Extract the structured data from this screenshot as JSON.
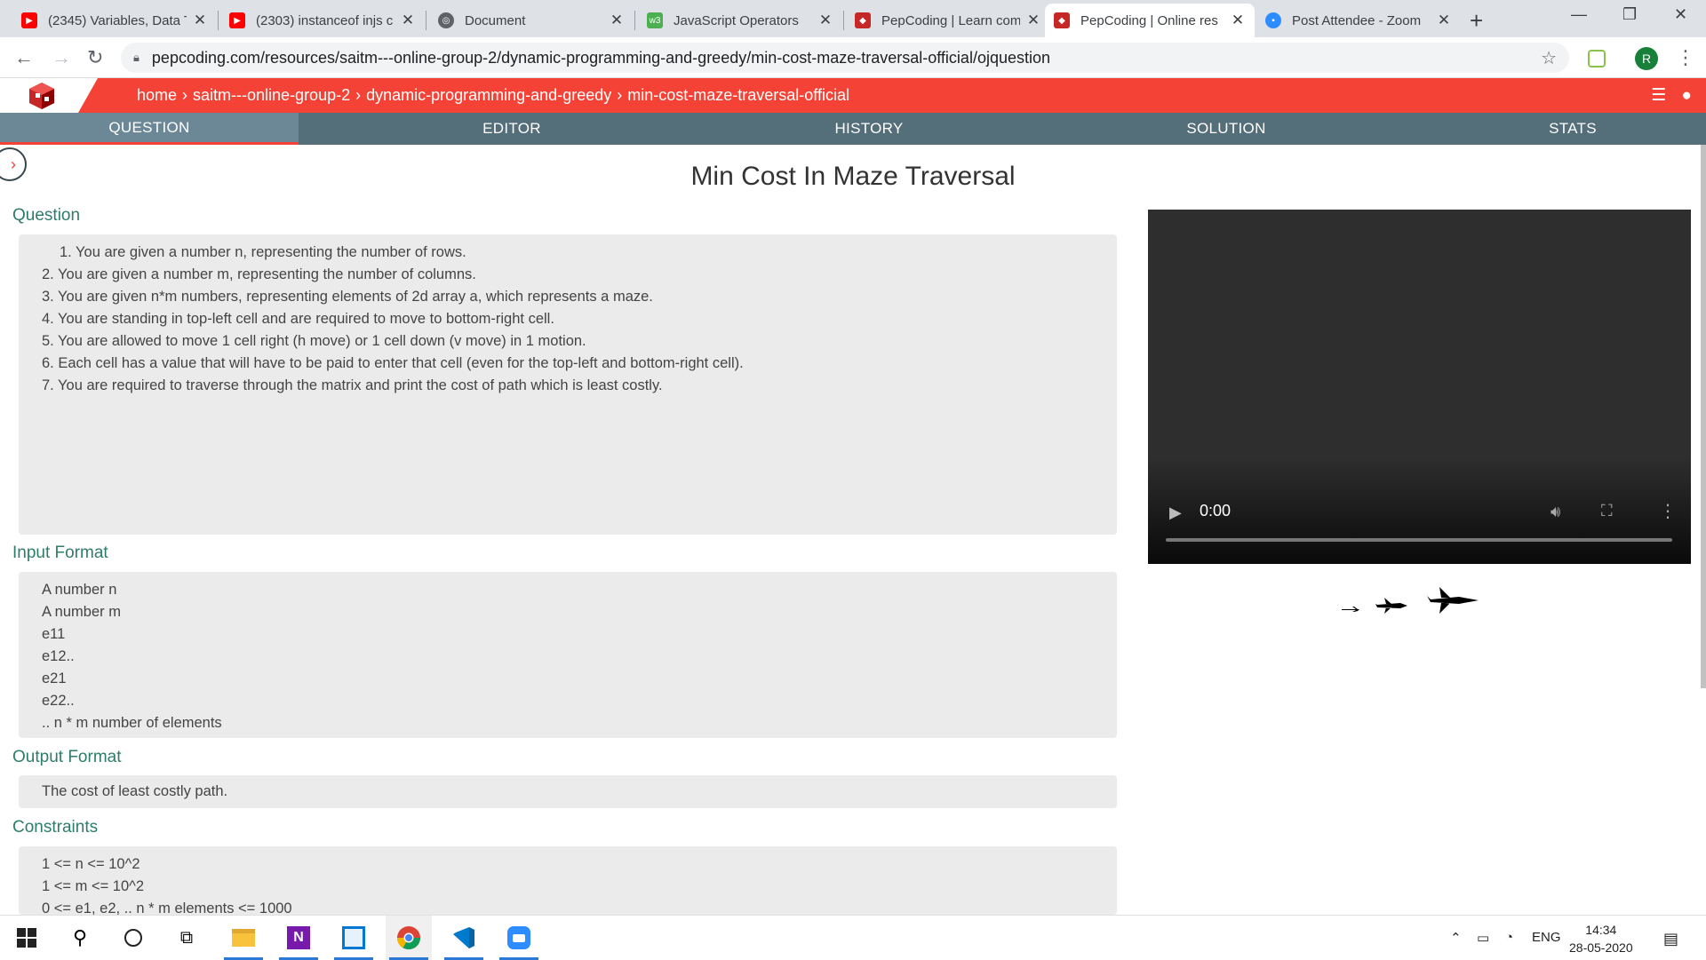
{
  "browser": {
    "tabs": [
      {
        "title": "(2345) Variables, Data T",
        "icon": "youtube-icon",
        "color": "#ff0000"
      },
      {
        "title": "(2303) instanceof injs c",
        "icon": "youtube-icon",
        "color": "#ff0000"
      },
      {
        "title": "Document",
        "icon": "globe-icon",
        "color": "#5f6368"
      },
      {
        "title": "JavaScript Operators",
        "icon": "w3-icon",
        "color": "#4caf50"
      },
      {
        "title": "PepCoding | Learn com",
        "icon": "pepcoding-icon",
        "color": "#c62828"
      },
      {
        "title": "PepCoding | Online res",
        "icon": "pepcoding-icon",
        "color": "#c62828",
        "active": true
      },
      {
        "title": "Post Attendee - Zoom",
        "icon": "zoom-icon",
        "color": "#2d8cff"
      }
    ],
    "url": "pepcoding.com/resources/saitm---online-group-2/dynamic-programming-and-greedy/min-cost-maze-traversal-official/ojquestion",
    "profile_initial": "R"
  },
  "header": {
    "breadcrumbs": [
      "home",
      "saitm---online-group-2",
      "dynamic-programming-and-greedy",
      "min-cost-maze-traversal-official"
    ]
  },
  "nav_tabs": [
    "QUESTION",
    "EDITOR",
    "HISTORY",
    "SOLUTION",
    "STATS"
  ],
  "page": {
    "title": "Min Cost In Maze Traversal",
    "question_label": "Question",
    "question_lines": [
      "1. You are given a number n, representing the number of rows.",
      "2. You are given a number m, representing the number of columns.",
      "3. You are given n*m numbers, representing elements of 2d array a, which represents a maze.",
      "4. You are standing in top-left cell and are required to move to bottom-right cell.",
      "5. You are allowed to move 1 cell right (h move) or 1 cell down (v move) in 1 motion.",
      "6. Each cell has a value that will have to be paid to enter that cell (even for the top-left and bottom-right cell).",
      "7. You are required to traverse through the matrix and print the cost of path which is least costly."
    ],
    "input_label": "Input Format",
    "input_lines": [
      "A number n",
      "A number m",
      "e11",
      "e12..",
      "e21",
      "e22..",
      ".. n * m number of elements"
    ],
    "output_label": "Output Format",
    "output_lines": [
      "The cost of least costly path."
    ],
    "constraints_label": "Constraints",
    "constraints_lines": [
      "1 <= n <= 10^2",
      "1 <= m <= 10^2",
      "0 <= e1, e2, .. n * m elements <= 1000"
    ]
  },
  "video": {
    "time": "0:00"
  },
  "taskbar": {
    "lang": "ENG",
    "time": "14:34",
    "date": "28-05-2020"
  },
  "colors": {
    "accent": "#f44336",
    "nav": "#546e7a",
    "label": "#2e7d6b"
  }
}
